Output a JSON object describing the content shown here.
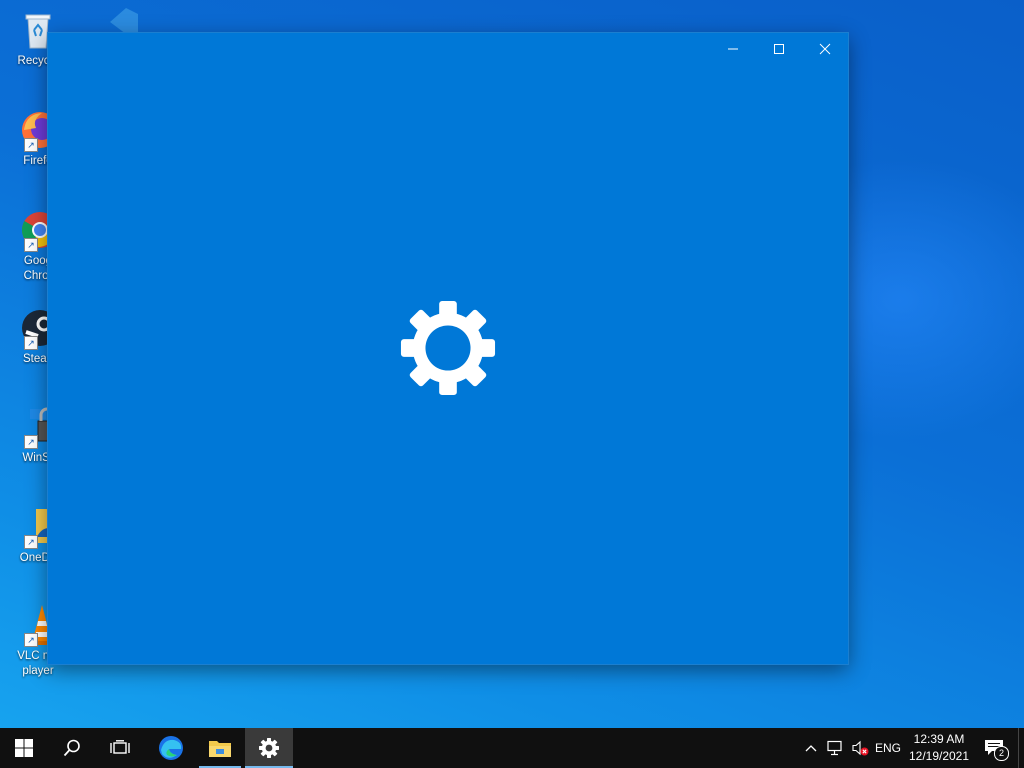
{
  "desktop": {
    "icons": [
      {
        "name": "recycle-bin",
        "label": "Recycle"
      },
      {
        "name": "firefox",
        "label": "Firefo"
      },
      {
        "name": "google-chrome",
        "label": "Goog\nChror"
      },
      {
        "name": "steam",
        "label": "Stean"
      },
      {
        "name": "winscp",
        "label": "WinS("
      },
      {
        "name": "onedrive",
        "label": "OneDri"
      },
      {
        "name": "vlc",
        "label": "VLC me\nplayer"
      }
    ]
  },
  "window": {
    "app": "Settings",
    "background_color": "#0078d7",
    "splash_icon": "gear-icon",
    "controls": [
      "minimize-icon",
      "maximize-icon",
      "close-icon"
    ]
  },
  "taskbar": {
    "buttons": [
      "windows-logo-icon",
      "search-icon",
      "task-view-icon",
      "edge-icon",
      "file-explorer-icon",
      "settings-gear-icon"
    ],
    "active": "settings",
    "tray": {
      "language": "ENG",
      "time": "12:39 AM",
      "date": "12/19/2021",
      "notification_count": "2"
    }
  }
}
